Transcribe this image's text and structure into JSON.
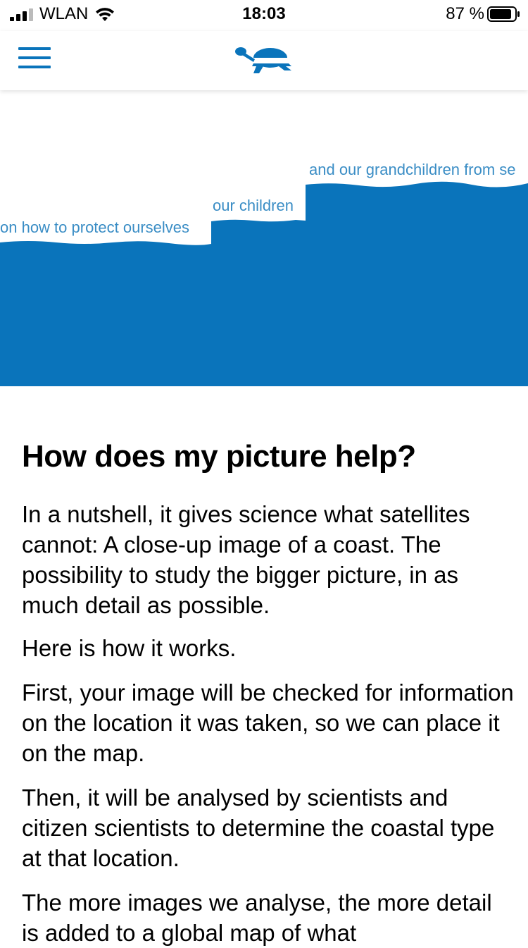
{
  "status_bar": {
    "carrier": "WLAN",
    "time": "18:03",
    "battery_percent": "87 %"
  },
  "nav": {
    "menu_icon": "hamburger-menu-icon",
    "logo_icon": "turtle-logo-icon"
  },
  "hero": {
    "labels": {
      "step1": "on how to protect ourselves",
      "step2": "our children",
      "step3": "and our grandchildren from se"
    },
    "colors": {
      "water": "#0a74bb",
      "label": "#3a8dc5"
    }
  },
  "content": {
    "heading": "How does my picture help?",
    "paragraphs": [
      "In a nutshell, it gives science what satellites cannot: A close-up image of a coast. The possibility to study the bigger picture, in as much detail as possible.",
      "Here is how it works.",
      "First, your image will be checked for information on the location it was taken, so we can place it on the map.",
      "Then, it will be analysed by scientists and citizen scientists to determine the coastal type at that location.",
      "The more images we analyse, the more detail is added to a global map of what"
    ]
  }
}
